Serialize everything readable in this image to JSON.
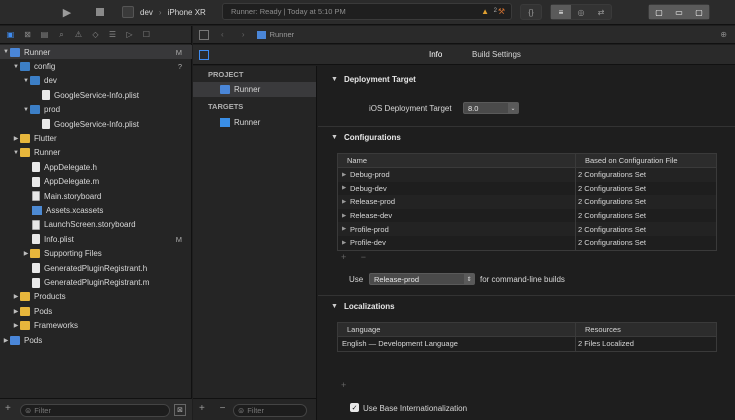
{
  "toolbar": {
    "scheme": "dev",
    "device": "iPhone XR",
    "status": "Runner: Ready | Today at 5:10 PM",
    "warnings": "2"
  },
  "navigator": {
    "items": [
      {
        "label": "Runner",
        "badge": "M"
      },
      {
        "label": "config",
        "badge": "?"
      },
      {
        "label": "dev"
      },
      {
        "label": "GoogleService-Info.plist"
      },
      {
        "label": "prod"
      },
      {
        "label": "GoogleService-Info.plist"
      },
      {
        "label": "Flutter"
      },
      {
        "label": "Runner"
      },
      {
        "label": "AppDelegate.h"
      },
      {
        "label": "AppDelegate.m"
      },
      {
        "label": "Main.storyboard"
      },
      {
        "label": "Assets.xcassets"
      },
      {
        "label": "LaunchScreen.storyboard"
      },
      {
        "label": "Info.plist",
        "badge": "M"
      },
      {
        "label": "Supporting Files"
      },
      {
        "label": "GeneratedPluginRegistrant.h"
      },
      {
        "label": "GeneratedPluginRegistrant.m"
      },
      {
        "label": "Products"
      },
      {
        "label": "Pods"
      },
      {
        "label": "Frameworks"
      },
      {
        "label": "Pods"
      }
    ],
    "filter_placeholder": "Filter"
  },
  "jumpbar": {
    "crumb": "Runner"
  },
  "tabs": {
    "info": "Info",
    "build_settings": "Build Settings"
  },
  "targets_pane": {
    "project_header": "PROJECT",
    "project_item": "Runner",
    "targets_header": "TARGETS",
    "target_item": "Runner",
    "filter_placeholder": "Filter"
  },
  "deployment": {
    "title": "Deployment Target",
    "ios_label": "iOS Deployment Target",
    "ios_value": "8.0"
  },
  "configurations": {
    "title": "Configurations",
    "col_name": "Name",
    "col_based": "Based on Configuration File",
    "rows": [
      {
        "name": "Debug-prod",
        "based": "2 Configurations Set"
      },
      {
        "name": "Debug-dev",
        "based": "2 Configurations Set"
      },
      {
        "name": "Release-prod",
        "based": "2 Configurations Set"
      },
      {
        "name": "Release-dev",
        "based": "2 Configurations Set"
      },
      {
        "name": "Profile-prod",
        "based": "2 Configurations Set"
      },
      {
        "name": "Profile-dev",
        "based": "2 Configurations Set"
      }
    ],
    "use_label": "Use",
    "use_value": "Release-prod",
    "use_suffix": "for command-line builds"
  },
  "localizations": {
    "title": "Localizations",
    "col_language": "Language",
    "col_resources": "Resources",
    "rows": [
      {
        "language": "English — Development Language",
        "resources": "2 Files Localized"
      }
    ],
    "base_intl_label": "Use Base Internationalization"
  }
}
